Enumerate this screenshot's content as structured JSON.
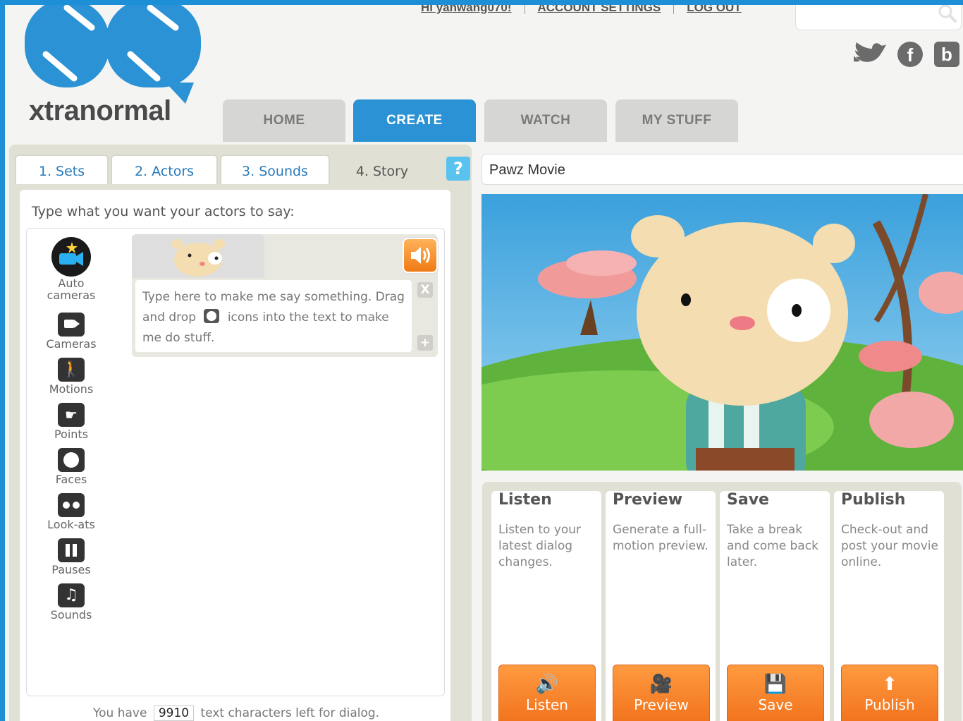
{
  "header": {
    "logo_text": "xtranormal",
    "greeting": "Hi yanwang070!",
    "account_settings": "ACCOUNT SETTINGS",
    "logout": "LOG OUT",
    "search": {
      "placeholder": ""
    },
    "social": [
      "twitter-icon",
      "facebook-icon",
      "blogger-icon"
    ],
    "facebook_glyph": "f",
    "blogger_glyph": "b"
  },
  "nav": {
    "tabs": [
      {
        "label": "HOME",
        "active": false
      },
      {
        "label": "CREATE",
        "active": true
      },
      {
        "label": "WATCH",
        "active": false
      },
      {
        "label": "MY STUFF",
        "active": false
      }
    ]
  },
  "steps": {
    "tabs": [
      {
        "label": "1. Sets",
        "active": false
      },
      {
        "label": "2. Actors",
        "active": false
      },
      {
        "label": "3. Sounds",
        "active": false
      },
      {
        "label": "4. Story",
        "active": true
      }
    ],
    "help": "?"
  },
  "editor": {
    "prompt": "Type what you want your actors to say:",
    "tools": [
      {
        "label": "Auto cameras",
        "icon": "auto-cameras-icon"
      },
      {
        "label": "Cameras",
        "icon": "camera-icon"
      },
      {
        "label": "Motions",
        "icon": "motion-icon"
      },
      {
        "label": "Points",
        "icon": "point-icon"
      },
      {
        "label": "Faces",
        "icon": "face-icon"
      },
      {
        "label": "Look-ats",
        "icon": "look-at-icon"
      },
      {
        "label": "Pauses",
        "icon": "pause-icon"
      },
      {
        "label": "Sounds",
        "icon": "music-note-icon"
      }
    ],
    "say_text_1": "Type here to make me say something. Drag and drop",
    "say_text_2": "icons into the text to make me do stuff.",
    "close_glyph": "X",
    "plus_glyph": "+",
    "chars_prefix": "You have",
    "chars_count": "9910",
    "chars_suffix": "text characters left for dialog."
  },
  "movie": {
    "title": "Pawz Movie"
  },
  "actions": [
    {
      "title": "Listen",
      "desc": "Listen to your latest dialog changes.",
      "button": "Listen",
      "icon": "speaker-icon"
    },
    {
      "title": "Preview",
      "desc": "Generate a full-motion preview.",
      "button": "Preview",
      "icon": "film-camera-icon"
    },
    {
      "title": "Save",
      "desc": "Take a break and come back later.",
      "button": "Save",
      "icon": "floppy-icon"
    },
    {
      "title": "Publish",
      "desc": "Check-out and post your movie online.",
      "button": "Publish",
      "icon": "publish-icon"
    }
  ],
  "colors": {
    "accent": "#2b92d5",
    "orange": "#f0701a",
    "frame": "#1c8fd6"
  }
}
